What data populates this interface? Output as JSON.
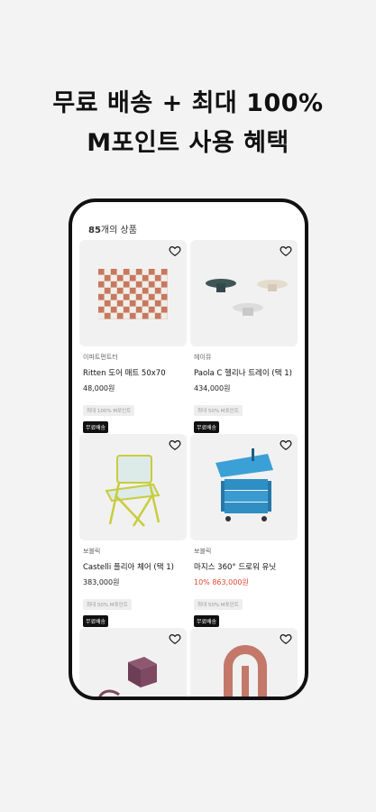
{
  "headline": {
    "line1": "무료 배송 + 최대 100%",
    "line2": "M포인트 사용 혜택"
  },
  "list": {
    "count_number": "85",
    "count_suffix": "개의 상품"
  },
  "products": [
    {
      "brand": "이파트먼트터",
      "name": "Ritten 도어 매트 50x70",
      "price": "48,000원",
      "discount": "",
      "sale_price": "",
      "points_badge": "최대 100% M포인트",
      "free_label": "무료배송"
    },
    {
      "brand": "헤이뮤",
      "name": "Paola C 헬리나 트레이 (택 1)",
      "price": "434,000원",
      "discount": "",
      "sale_price": "",
      "points_badge": "최대 50% M포인트",
      "free_label": "무료배송"
    },
    {
      "brand": "보블릭",
      "name": "Castelli 플리아 체어 (택 1)",
      "price": "383,000원",
      "discount": "",
      "sale_price": "",
      "points_badge": "최대 50% M포인트",
      "free_label": "무료배송"
    },
    {
      "brand": "보블릭",
      "name": "마지스 360° 드로워 유닛",
      "price": "",
      "discount": "10%",
      "sale_price": "863,000원",
      "points_badge": "최대 50% M포인트",
      "free_label": "무료배송"
    }
  ]
}
